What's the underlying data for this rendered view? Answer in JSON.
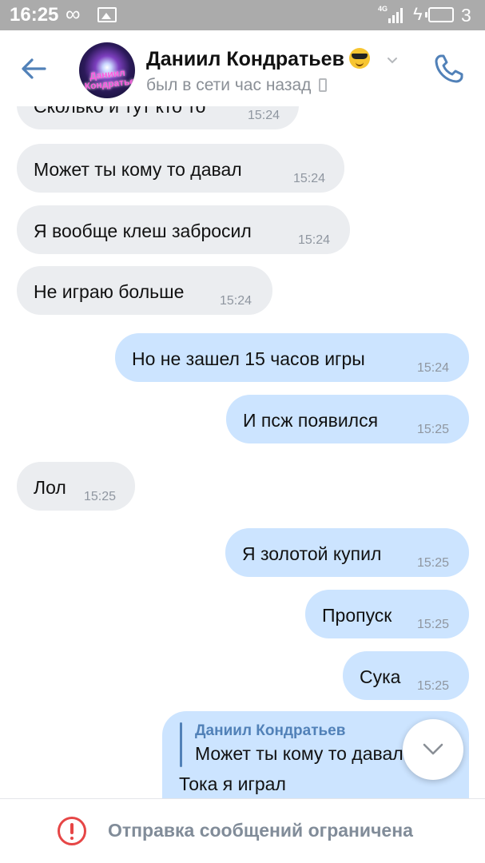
{
  "status_bar": {
    "time": "16:25",
    "infinity_symbol": "∞",
    "network": "4G",
    "battery_level": "3"
  },
  "header": {
    "contact_name": "Даниил Кондратьев",
    "status": "был в сети час назад",
    "avatar_text": "Даниил Кондратьев",
    "accent_color": "#5181b8"
  },
  "messages": [
    {
      "direction": "in",
      "text": "Сколько и тут кто то",
      "time": "15:24"
    },
    {
      "direction": "in",
      "text": "Может ты кому то давал",
      "time": "15:24"
    },
    {
      "direction": "in",
      "text": "Я вообще клеш забросил",
      "time": "15:24"
    },
    {
      "direction": "in",
      "text": "Не играю больше",
      "time": "15:24"
    },
    {
      "direction": "out",
      "text": "Но не зашел 15 часов игры",
      "time": "15:24"
    },
    {
      "direction": "out",
      "text": "И псж появился",
      "time": "15:25"
    },
    {
      "direction": "in",
      "text": "Лол",
      "time": "15:25"
    },
    {
      "direction": "out",
      "text": "Я золотой купил",
      "time": "15:25"
    },
    {
      "direction": "out",
      "text": "Пропуск",
      "time": "15:25"
    },
    {
      "direction": "out",
      "text": "Сука",
      "time": "15:25"
    }
  ],
  "reply_message": {
    "quoted_author": "Даниил Кондратьев",
    "quoted_text": "Может ты кому то давал",
    "text": "Тока я играл"
  },
  "bottom_bar": {
    "text": "Отправка сообщений ограничена"
  },
  "colors": {
    "incoming_bubble": "#ebedf0",
    "outgoing_bubble": "#cce4ff",
    "warning": "#e64646"
  }
}
